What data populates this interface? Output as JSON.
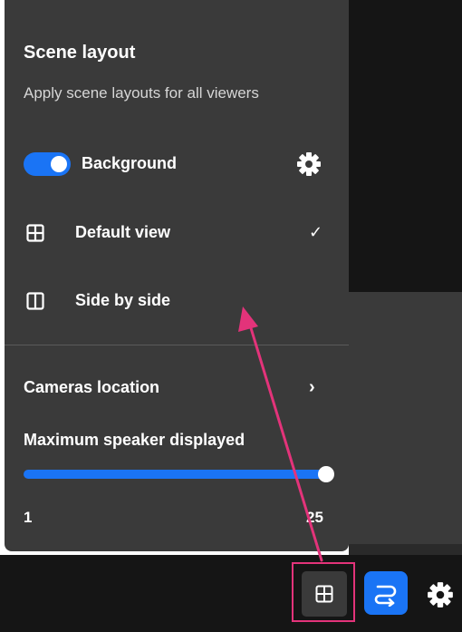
{
  "panel": {
    "title": "Scene layout",
    "subtitle": "Apply scene layouts for all viewers",
    "background_toggle": {
      "label": "Background",
      "enabled": true
    },
    "layouts": [
      {
        "label": "Default view",
        "icon": "grid-2x2-icon",
        "selected": true,
        "check": "✓"
      },
      {
        "label": "Side by side",
        "icon": "split-columns-icon",
        "selected": false,
        "check": ""
      }
    ],
    "cameras_location": {
      "label": "Cameras location",
      "chevron": "›"
    },
    "max_speakers": {
      "label": "Maximum speaker displayed",
      "min": "1",
      "max": "25",
      "value": 25
    }
  },
  "toolbar": {
    "layout_button_icon": "grid-2x2-icon",
    "stage_button_icon": "stage-transfer-icon",
    "settings_icon": "gear-icon"
  },
  "colors": {
    "panel_bg": "#3a3a3a",
    "accent": "#1a74f5",
    "annotation": "#e3337a",
    "bar_bg": "#151515"
  }
}
